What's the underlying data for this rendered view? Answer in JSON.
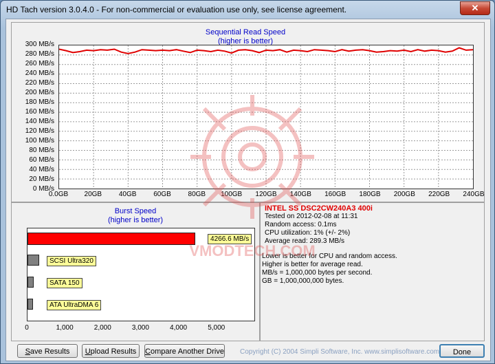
{
  "window": {
    "title": "HD Tach version 3.0.4.0  - For non-commercial or evaluation use only, see license agreement.",
    "close_glyph": "✕"
  },
  "sequential": {
    "title": "Sequential Read Speed",
    "subtitle": "(higher is better)",
    "y_ticks": [
      "300 MB/s",
      "280 MB/s",
      "260 MB/s",
      "240 MB/s",
      "220 MB/s",
      "200 MB/s",
      "180 MB/s",
      "160 MB/s",
      "140 MB/s",
      "120 MB/s",
      "100 MB/s",
      "80 MB/s",
      "60 MB/s",
      "40 MB/s",
      "20 MB/s",
      "0 MB/s"
    ],
    "x_ticks": [
      "0.0GB",
      "20GB",
      "40GB",
      "60GB",
      "80GB",
      "100GB",
      "120GB",
      "140GB",
      "160GB",
      "180GB",
      "200GB",
      "220GB",
      "240GB"
    ]
  },
  "chart_data": {
    "type": "line",
    "xlim": [
      0,
      240
    ],
    "ylim": [
      0,
      300
    ],
    "x_unit": "GB",
    "y_unit": "MB/s",
    "grid": true,
    "color": "#e00000",
    "series": [
      {
        "x": [
          0,
          4,
          8,
          12,
          16,
          20,
          24,
          28,
          32,
          36,
          40,
          44,
          48,
          52,
          56,
          60,
          64,
          68,
          72,
          76,
          80,
          84,
          88,
          92,
          96,
          100,
          104,
          108,
          112,
          116,
          120,
          124,
          128,
          132,
          136,
          140,
          144,
          148,
          152,
          156,
          160,
          164,
          168,
          172,
          176,
          180,
          184,
          188,
          192,
          196,
          200,
          204,
          208,
          212,
          216,
          220,
          224,
          228,
          232,
          236,
          240
        ],
        "y": [
          292,
          289,
          285,
          287,
          290,
          289,
          291,
          290,
          292,
          286,
          283,
          286,
          291,
          290,
          289,
          290,
          289,
          291,
          288,
          285,
          290,
          289,
          287,
          290,
          288,
          284,
          290,
          291,
          289,
          285,
          290,
          289,
          291,
          286,
          290,
          289,
          287,
          291,
          290,
          289,
          287,
          291,
          288,
          290,
          291,
          289,
          286,
          287,
          289,
          288,
          290,
          287,
          291,
          288,
          290,
          289,
          286,
          288,
          295,
          290,
          291
        ]
      }
    ]
  },
  "burst": {
    "title": "Burst Speed",
    "subtitle": "(higher is better)",
    "x_ticks": [
      "0",
      "1,000",
      "2,000",
      "3,000",
      "4,000",
      "5,000"
    ],
    "xlim": [
      0,
      6000
    ],
    "bars": [
      {
        "label": "4266.6 MB/s",
        "value": 4266.6,
        "color": "#ff0000"
      },
      {
        "label": "SCSI Ultra320",
        "value": 300,
        "color": "#808080"
      },
      {
        "label": "SATA 150",
        "value": 150,
        "color": "#808080"
      },
      {
        "label": "ATA UltraDMA 6",
        "value": 133,
        "color": "#808080"
      }
    ]
  },
  "info": {
    "drive": "INTEL SS DSC2CW240A3 400i",
    "lines": [
      "Tested on 2012-02-08 at 11:31",
      "Random access: 0.1ms",
      "CPU utilization: 1% (+/- 2%)",
      "Average read: 289.3 MB/s"
    ],
    "notes": [
      "Lower is better for CPU and random access.",
      "Higher is better for average read.",
      "MB/s = 1,000,000 bytes per second.",
      "GB = 1,000,000,000 bytes."
    ]
  },
  "buttons": {
    "save": "Save Results",
    "upload": "Upload Results",
    "compare": "Compare Another Drive",
    "done": "Done"
  },
  "copyright": "Copyright (C) 2004 Simpli Software, Inc. www.simplisoftware.com",
  "watermark": {
    "text": "VMODTECH.COM"
  }
}
